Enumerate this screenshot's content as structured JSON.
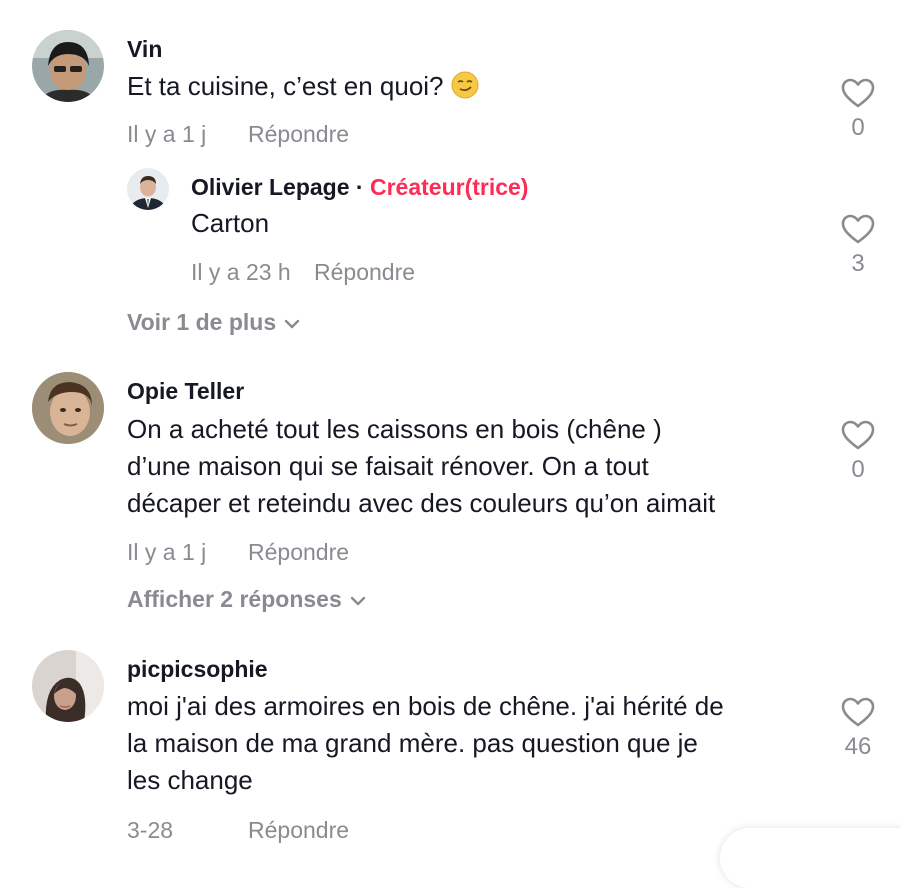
{
  "comments": [
    {
      "username": "Vin",
      "text": "Et ta cuisine, c’est en quoi? ",
      "emoji": "smirking-face-icon",
      "time": "Il y a 1 j",
      "reply_label": "Répondre",
      "likes": "0",
      "replies": [
        {
          "username": "Olivier Lepage",
          "separator": " · ",
          "badge": "Créateur(trice)",
          "text": "Carton",
          "time": "Il y a 23 h",
          "reply_label": "Répondre",
          "likes": "3"
        }
      ],
      "more_label": "Voir 1 de plus"
    },
    {
      "username": "Opie Teller",
      "text_lines": [
        "On a acheté tout les caissons en bois (chêne )",
        "d’une maison qui se faisait rénover. On a tout",
        "décaper et reteindu avec des couleurs qu’on aimait"
      ],
      "time": "Il y a 1 j",
      "reply_label": "Répondre",
      "likes": "0",
      "more_label": "Afficher 2 réponses"
    },
    {
      "username": "picpicsophie",
      "text_lines": [
        "moi j'ai des armoires en bois de chêne. j'ai hérité de",
        "la maison de ma grand mère. pas question que je",
        "les change"
      ],
      "time": "3-28",
      "reply_label": "Répondre",
      "likes": "46"
    }
  ],
  "colors": {
    "creator_badge": "#fe2c55",
    "secondary_text": "#8a8b91",
    "primary_text": "#161823"
  }
}
